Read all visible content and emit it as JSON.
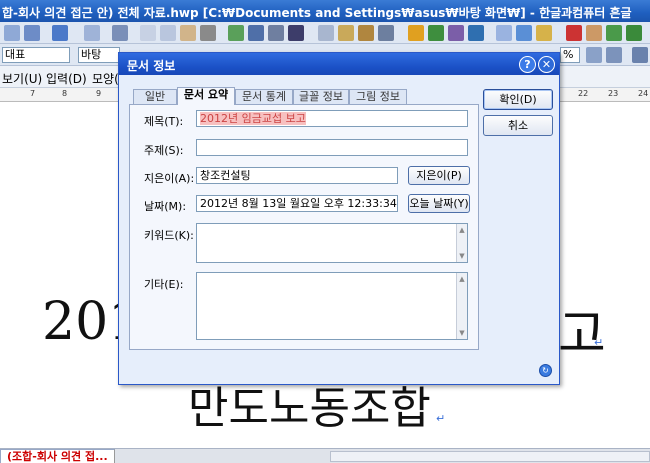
{
  "window": {
    "title": "합-회사 의견 접근 안) 전체 자료.hwp [C:₩Documents and Settings₩asus₩바탕 화면₩] - 한글과컴퓨터 흔글"
  },
  "toolbar2": {
    "style_combo": "대표",
    "font_combo": "바탕",
    "zoom_combo": "%"
  },
  "menubar": {
    "items": [
      "보기(U)",
      "입력(D)",
      "모양("
    ]
  },
  "ruler": {
    "ticks": [
      "7",
      "8",
      "9",
      "22",
      "23",
      "24"
    ]
  },
  "document": {
    "line1_left": "201",
    "line1_right": "고",
    "line2": "만도노동조합",
    "para_mark": "↵"
  },
  "statusbar": {
    "doc_tab": "(조합-회사 의견 접..."
  },
  "dialog": {
    "title": "문서 정보",
    "help_glyph": "?",
    "close_glyph": "✕",
    "tabs": [
      {
        "label": "일반",
        "active": false
      },
      {
        "label": "문서 요약",
        "active": true
      },
      {
        "label": "문서 통계",
        "active": false
      },
      {
        "label": "글꼴 정보",
        "active": false
      },
      {
        "label": "그림 정보",
        "active": false
      }
    ],
    "fields": {
      "title_label": "제목(T):",
      "title_value": "2012년 임금교섭 보고",
      "subject_label": "주제(S):",
      "subject_value": "",
      "author_label": "지은이(A):",
      "author_value": "창조컨설팅",
      "date_label": "날짜(M):",
      "date_value": "2012년 8월 13일 월요일 오후 12:33:34",
      "keyword_label": "키워드(K):",
      "other_label": "기타(E):"
    },
    "buttons": {
      "ok": "확인(D)",
      "cancel": "취소",
      "author": "지은이(P)",
      "today": "오늘 날짜(Y)"
    }
  }
}
